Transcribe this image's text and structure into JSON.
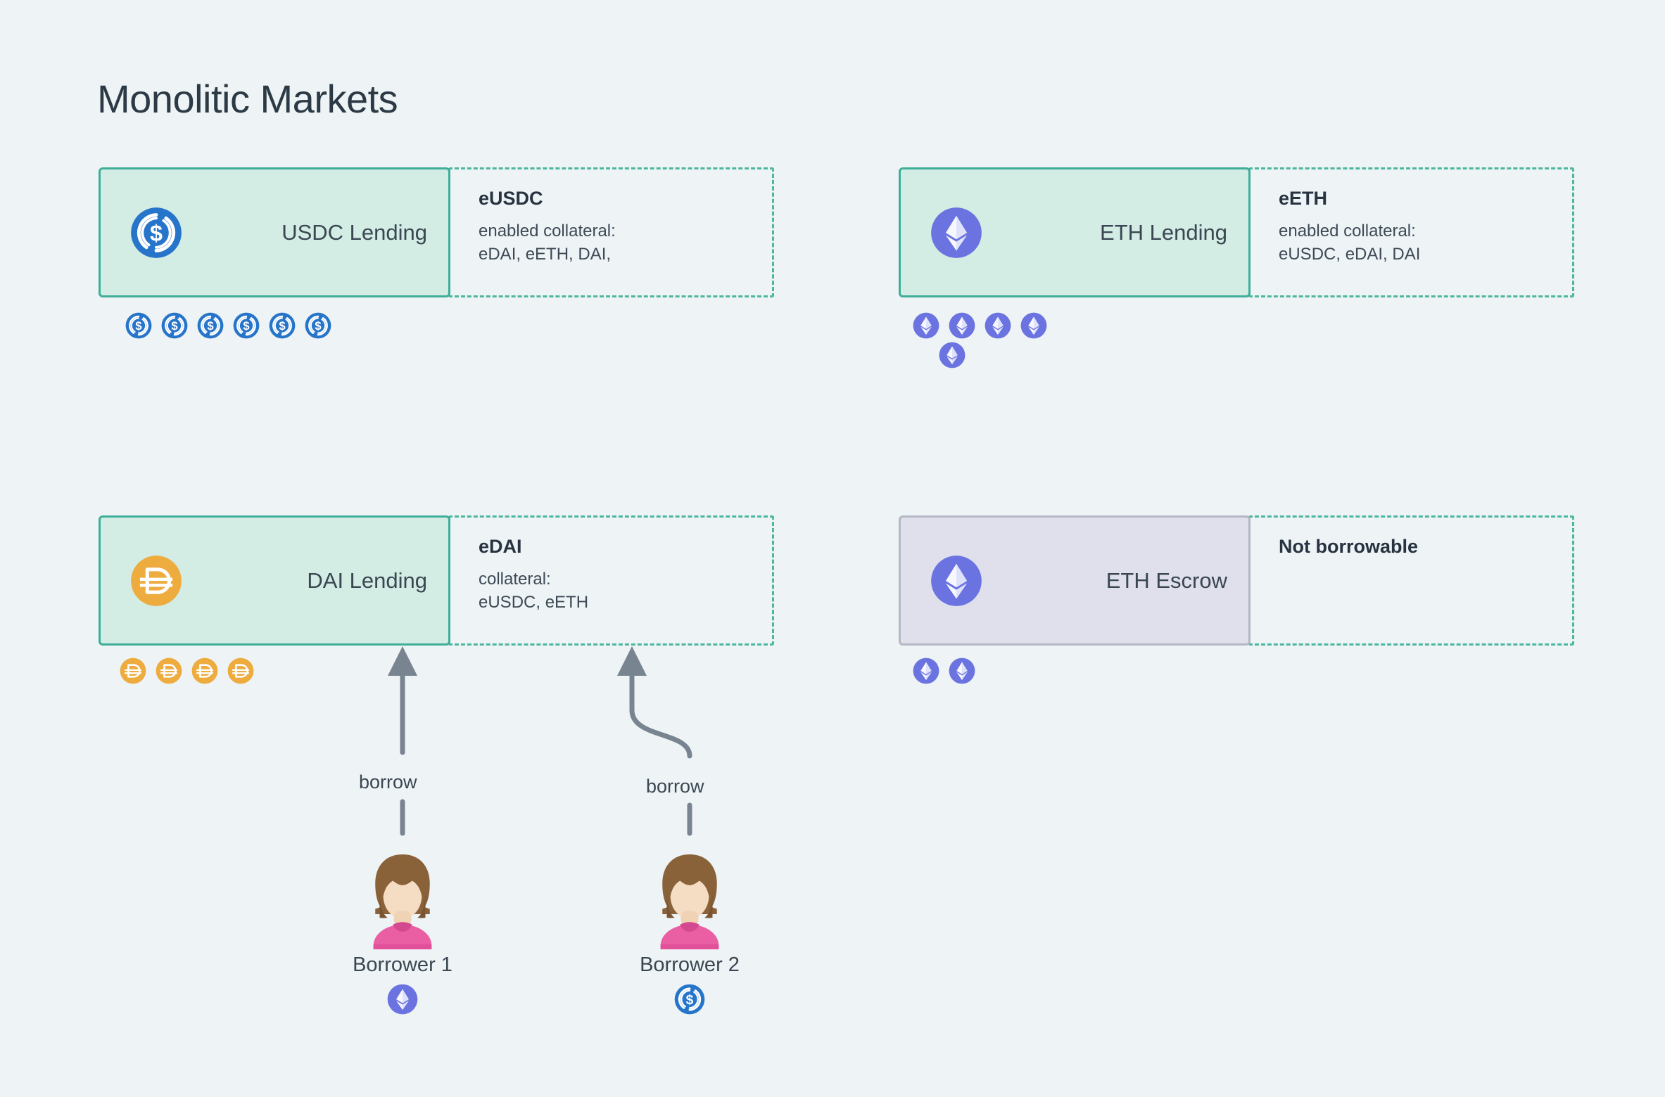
{
  "page": {
    "title": "Monolitic Markets",
    "background_color": "#eef3f5"
  },
  "colors": {
    "card_fill": "#d3ece4",
    "card_border": "#3fae99",
    "escrow_fill": "#dfe0ec",
    "escrow_border": "#b4b8c4",
    "dashed_border": "#4cb79e",
    "usdc_blue": "#2775ca",
    "eth_purple": "#6b73e0",
    "dai_orange": "#eeab3e",
    "arrow_gray": "#78848f",
    "text_dark": "#3a4752"
  },
  "markets": [
    {
      "id": "usdc-lending",
      "label": "USDC Lending",
      "icon": "usdc-coin-icon",
      "style": "lending",
      "meta": {
        "title": "eUSDC",
        "lines": [
          "enabled collateral:",
          "eDAI, eETH, DAI,"
        ]
      },
      "deposits": {
        "token": "usdc-coin-icon",
        "count": 6,
        "extra": 0
      }
    },
    {
      "id": "eth-lending",
      "label": "ETH Lending",
      "icon": "eth-coin-icon",
      "style": "lending",
      "meta": {
        "title": "eETH",
        "lines": [
          "enabled collateral:",
          "eUSDC, eDAI, DAI"
        ]
      },
      "deposits": {
        "token": "eth-coin-icon",
        "count": 4,
        "extra": 1
      }
    },
    {
      "id": "dai-lending",
      "label": "DAI Lending",
      "icon": "dai-coin-icon",
      "style": "lending",
      "meta": {
        "title": "eDAI",
        "lines": [
          "collateral:",
          "eUSDC, eETH"
        ]
      },
      "deposits": {
        "token": "dai-coin-icon",
        "count": 4,
        "extra": 0
      }
    },
    {
      "id": "eth-escrow",
      "label": "ETH Escrow",
      "icon": "eth-coin-icon",
      "style": "escrow",
      "meta": {
        "title": "Not borrowable",
        "lines": []
      },
      "deposits": {
        "token": "eth-coin-icon",
        "count": 2,
        "extra": 0
      }
    }
  ],
  "borrowers": [
    {
      "id": "borrower-1",
      "name": "Borrower 1",
      "collateral_token": "eth-coin-icon",
      "edge_label": "borrow"
    },
    {
      "id": "borrower-2",
      "name": "Borrower 2",
      "collateral_token": "usdc-coin-icon",
      "edge_label": "borrow"
    }
  ]
}
